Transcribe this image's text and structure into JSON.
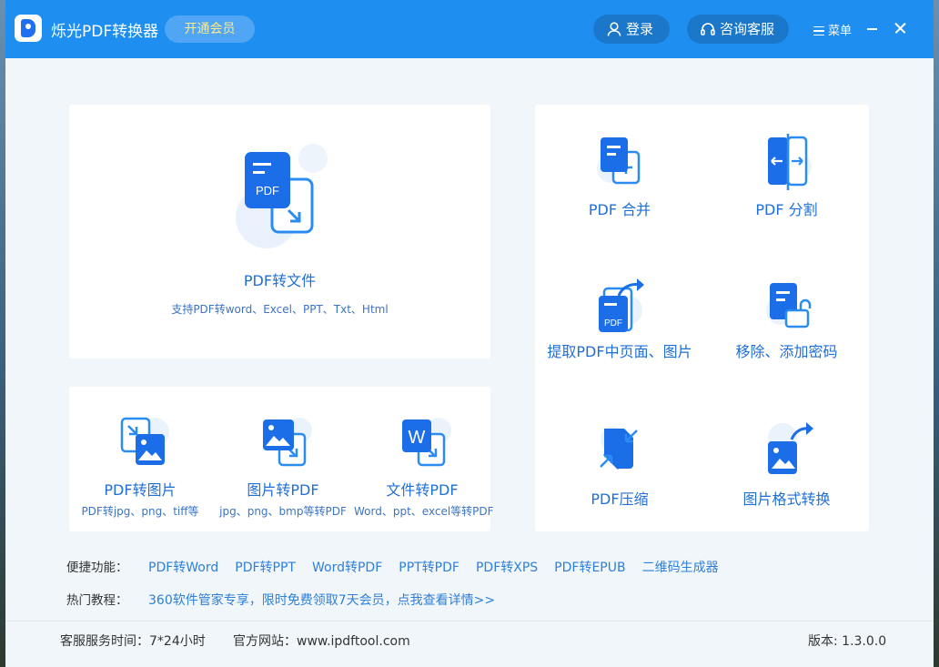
{
  "window": {
    "title": "烁光PDF转换器",
    "vip_label": "开通会员",
    "login_label": "登录",
    "service_label": "咨询客服",
    "menu_label": "菜单"
  },
  "main_tool": {
    "label": "PDF转文件",
    "desc": "支持PDF转word、Excel、PPT、Txt、Html",
    "icon_text": "PDF"
  },
  "small_tools": [
    {
      "label": "PDF转图片",
      "desc": "PDF转jpg、png、tiff等",
      "icon": "pdf-to-image-icon"
    },
    {
      "label": "图片转PDF",
      "desc": "jpg、png、bmp等转PDF",
      "icon": "image-to-pdf-icon"
    },
    {
      "label": "文件转PDF",
      "desc": "Word、ppt、excel等转PDF",
      "icon": "file-to-pdf-icon",
      "icon_text": "W"
    }
  ],
  "right_tools": [
    {
      "label": "PDF 合并",
      "icon": "pdf-merge-icon"
    },
    {
      "label": "PDF 分割",
      "icon": "pdf-split-icon"
    },
    {
      "label": "提取PDF中页面、图片",
      "icon": "extract-pages-icon",
      "icon_text": "PDF"
    },
    {
      "label": "移除、添加密码",
      "icon": "password-lock-icon"
    },
    {
      "label": "PDF压缩",
      "icon": "pdf-compress-icon"
    },
    {
      "label": "图片格式转换",
      "icon": "image-format-convert-icon"
    }
  ],
  "quick": {
    "label": "便捷功能：",
    "links": [
      "PDF转Word",
      "PDF转PPT",
      "Word转PDF",
      "PPT转PDF",
      "PDF转XPS",
      "PDF转EPUB",
      "二维码生成器"
    ]
  },
  "hot": {
    "label": "热门教程：",
    "link": "360软件管家专享，限时免费领取7天会员，点我查看详情>>"
  },
  "footer": {
    "service_time": "客服服务时间：7*24小时",
    "website": "官方网站：www.ipdftool.com",
    "version": "版本: 1.3.0.0"
  },
  "colors": {
    "titlebar": "#1f8ef1",
    "accent": "#1f6fd6",
    "link": "#2f7fd8",
    "vip_text": "#ffe98a"
  }
}
